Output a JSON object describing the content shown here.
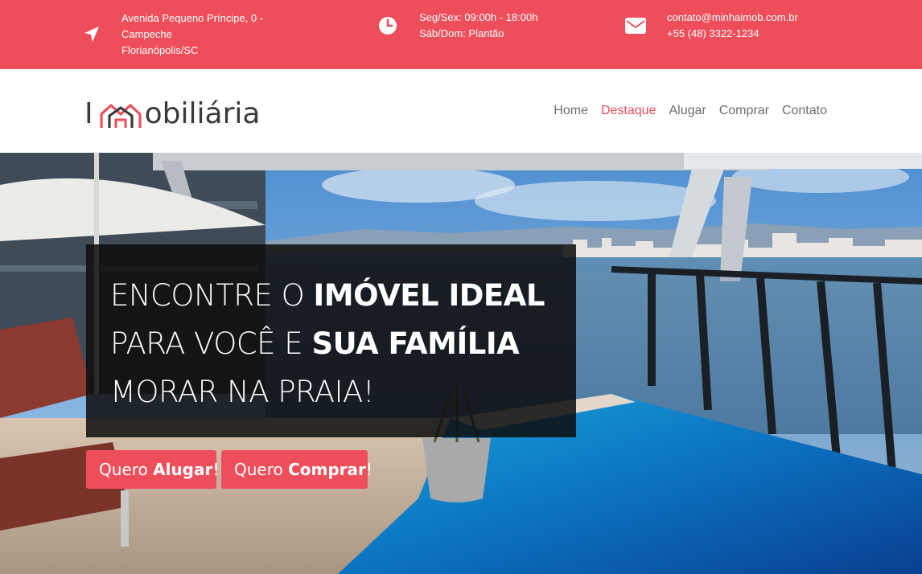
{
  "topbar": {
    "address": {
      "icon": "location-arrow-icon",
      "line1": "Avenida Pequeno Príncipe, 0 -",
      "line2": "Campeche",
      "line3": "Florianópolis/SC"
    },
    "hours": {
      "icon": "clock-icon",
      "line1": "Seg/Sex: 09:00h - 18:00h",
      "line2": "Sáb/Dom: Plantão"
    },
    "contact": {
      "icon": "envelope-icon",
      "email": "contato@minhaimob.com.br",
      "phone": "+55 (48) 3322-1234"
    }
  },
  "header": {
    "logo": {
      "first": "I",
      "rest": "obiliária",
      "icon": "house-logo-icon"
    },
    "nav": [
      {
        "label": "Home",
        "active": false
      },
      {
        "label": "Destaque",
        "active": true
      },
      {
        "label": "Alugar",
        "active": false
      },
      {
        "label": "Comprar",
        "active": false
      },
      {
        "label": "Contato",
        "active": false
      }
    ]
  },
  "hero": {
    "line1_light": "ENCONTRE O ",
    "line1_bold": "IMÓVEL IDEAL",
    "line2_light": "PARA VOCÊ E ",
    "line2_bold": "SUA FAMÍLIA",
    "line3_light": "MORAR NA PRAIA!",
    "cta_rent": {
      "prefix": "Quero ",
      "bold": "Alugar",
      "suffix": "!"
    },
    "cta_buy": {
      "prefix": "Quero ",
      "bold": "Comprar",
      "suffix": "!"
    }
  },
  "colors": {
    "accent": "#ed4e5a",
    "nav_text": "#6d6d6d",
    "logo_text": "#3a3a3a"
  }
}
